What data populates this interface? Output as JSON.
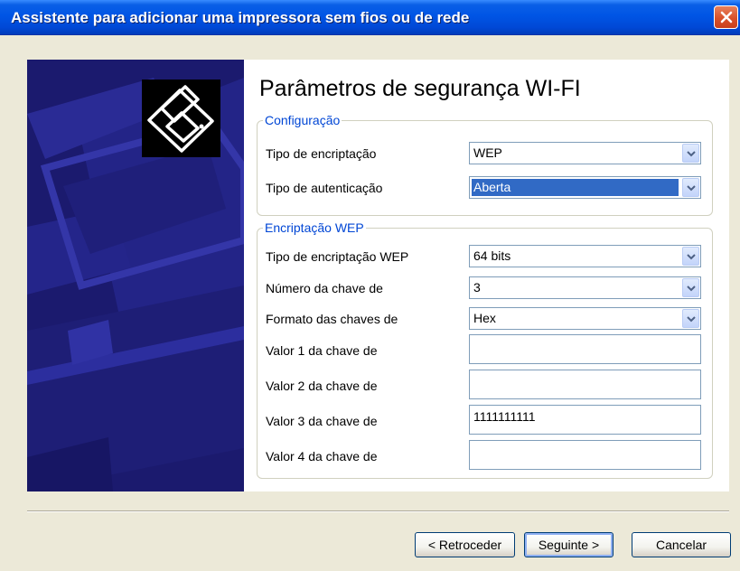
{
  "window": {
    "title": "Assistente para adicionar uma impressora sem fios ou de rede"
  },
  "page": {
    "heading": "Parâmetros de segurança WI-FI"
  },
  "configuration": {
    "legend": "Configuração",
    "encryption_type_label": "Tipo de encriptação",
    "encryption_type_value": "WEP",
    "authentication_type_label": "Tipo de autenticação",
    "authentication_type_value": "Aberta"
  },
  "wep": {
    "legend": "Encriptação WEP",
    "wep_encryption_type_label": "Tipo de encriptação WEP",
    "wep_encryption_type_value": "64 bits",
    "key_number_label": "Número da chave de",
    "key_number_value": "3",
    "key_format_label": "Formato das chaves de",
    "key_format_value": "Hex",
    "key_values": [
      {
        "label": "Valor 1 da chave de",
        "value": ""
      },
      {
        "label": "Valor 2 da chave de",
        "value": ""
      },
      {
        "label": "Valor 3 da chave de",
        "value": "1111111111"
      },
      {
        "label": "Valor 4 da chave de",
        "value": ""
      }
    ]
  },
  "buttons": {
    "back": "< Retroceder",
    "next": "Seguinte >",
    "cancel": "Cancelar"
  },
  "icons": {
    "close": "close-icon",
    "printer_logo": "printer-icon",
    "dropdown": "chevron-down-icon"
  },
  "colors": {
    "titlebar": "#0055E5",
    "legend_text": "#0046D5",
    "left_panel": "#1B1A6E",
    "selection": "#316AC5",
    "close_button": "#D9512A"
  }
}
